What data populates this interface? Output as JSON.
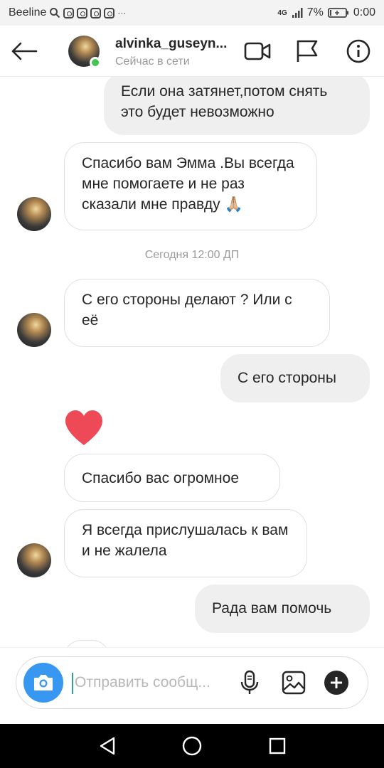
{
  "status_bar": {
    "carrier": "Beeline",
    "network": "4G",
    "battery": "7%",
    "time": "0:00",
    "ellipsis": "···"
  },
  "header": {
    "username": "alvinka_guseyn...",
    "status": "Сейчас в сети",
    "online_color": "#44c553"
  },
  "messages": [
    {
      "id": "m1",
      "direction": "out",
      "text": "Если она затянет,потом снять это будет невозможно"
    },
    {
      "id": "m2",
      "direction": "in",
      "text": "Спасибо вам Эмма .Вы всегда мне помогаете и не раз сказали мне правду 🙏🏼"
    },
    {
      "id": "m3",
      "direction": "in",
      "text": "С его стороны делают ? Или с её"
    },
    {
      "id": "m4",
      "direction": "out",
      "text": "С его стороны"
    },
    {
      "id": "m5",
      "direction": "in",
      "text": "Спасибо вас огромное"
    },
    {
      "id": "m6",
      "direction": "in",
      "text": "Я всегда прислушалась к вам и не жалела"
    },
    {
      "id": "m7",
      "direction": "out",
      "text": "Рада вам помочь"
    }
  ],
  "timestamp": "Сегодня 12:00 ДП",
  "reaction": "heart",
  "composer": {
    "placeholder": "Отправить сообщ...",
    "camera_color": "#3897f0"
  },
  "icons": {
    "header": [
      "back-arrow-icon",
      "video-call-icon",
      "flag-icon",
      "info-icon"
    ],
    "composer": [
      "camera-icon",
      "microphone-icon",
      "gallery-icon",
      "plus-icon"
    ],
    "nav": [
      "nav-back-icon",
      "nav-home-icon",
      "nav-recents-icon"
    ]
  }
}
